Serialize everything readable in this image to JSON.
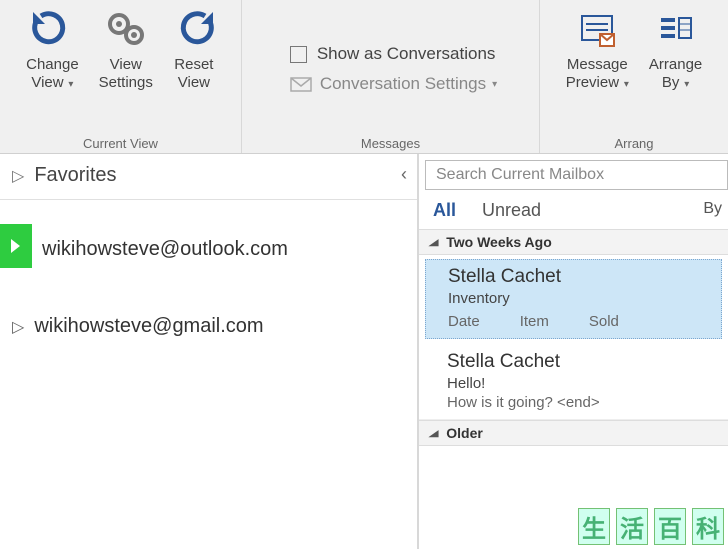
{
  "ribbon": {
    "groups": {
      "current_view": {
        "label": "Current View",
        "change_view": "Change\nView",
        "view_settings": "View\nSettings",
        "reset_view": "Reset\nView"
      },
      "messages": {
        "label": "Messages",
        "show_as_conversations": "Show as Conversations",
        "conversation_settings": "Conversation Settings"
      },
      "arrangement": {
        "label": "Arrang",
        "message_preview": "Message\nPreview",
        "arrange_by": "Arrange\nBy"
      }
    }
  },
  "nav": {
    "favorites": "Favorites",
    "accounts": [
      "wikihowsteve@outlook.com",
      "wikihowsteve@gmail.com"
    ]
  },
  "messages": {
    "search_placeholder": "Search Current Mailbox",
    "filters": {
      "all": "All",
      "unread": "Unread",
      "by": "By"
    },
    "group1": "Two Weeks Ago",
    "group2": "Older",
    "items": [
      {
        "sender": "Stella Cachet",
        "subject": "Inventory",
        "col1": "Date",
        "col2": "Item",
        "col3": "Sold"
      },
      {
        "sender": "Stella Cachet",
        "subject": "Hello!",
        "preview": "How is it going? <end>"
      }
    ]
  }
}
